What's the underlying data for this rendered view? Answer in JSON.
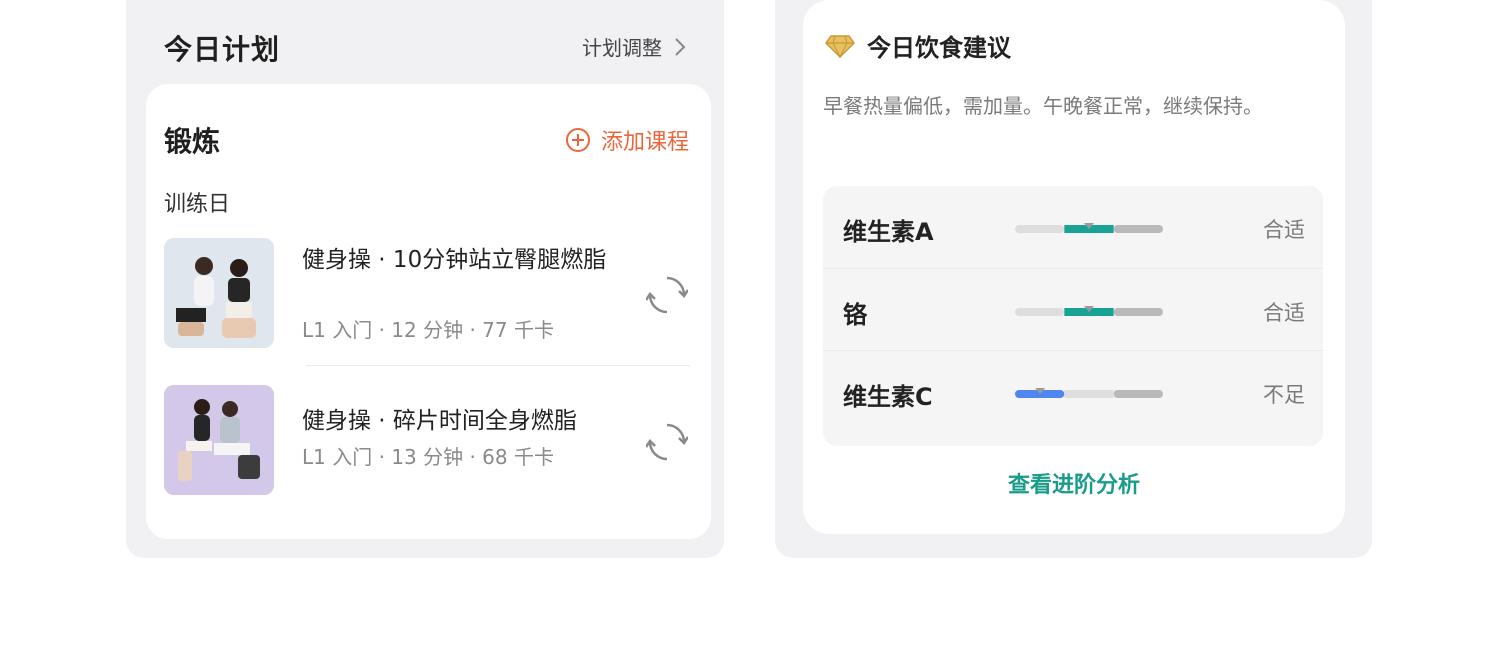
{
  "plan": {
    "title": "今日计划",
    "adjust_label": "计划调整",
    "exercise": {
      "title": "锻炼",
      "add_course_label": "添加课程",
      "day_label": "训练日",
      "courses": [
        {
          "name": "健身操 · 10分钟站立臀腿燃脂",
          "meta": "L1 入门 · 12 分钟 · 77 千卡"
        },
        {
          "name": "健身操 · 碎片时间全身燃脂",
          "meta": "L1 入门 · 13 分钟 · 68 千卡"
        }
      ]
    }
  },
  "diet": {
    "title": "今日饮食建议",
    "description": "早餐热量偏低，需加量。午晚餐正常，继续保持。",
    "nutrients": [
      {
        "name": "维生素A",
        "status": "合适",
        "level": 0.5,
        "color": "#19a394"
      },
      {
        "name": "铬",
        "status": "合适",
        "level": 0.5,
        "color": "#19a394"
      },
      {
        "name": "维生素C",
        "status": "不足",
        "level": 0.17,
        "color": "#4f86f0"
      }
    ],
    "advanced_label": "查看进阶分析"
  },
  "colors": {
    "accent_orange": "#e9683b",
    "accent_teal": "#1a9c8a",
    "panel_bg": "#f1f1f3"
  },
  "icons": [
    "chevron-right-icon",
    "plus-circle-icon",
    "refresh-icon",
    "diamond-icon"
  ]
}
